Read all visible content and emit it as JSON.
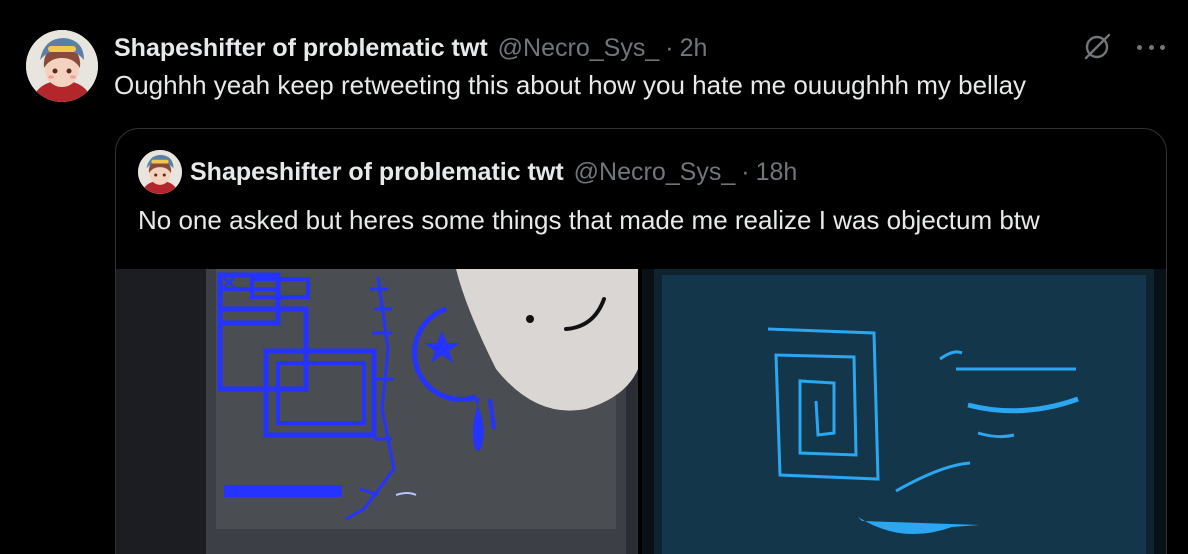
{
  "tweet": {
    "author_name": "Shapeshifter of problematic twt",
    "author_handle": "@Necro_Sys_",
    "separator": "·",
    "time": "2h",
    "text": "Oughhh yeah keep retweeting this about how you hate me ouuughhh my bellay",
    "icons": {
      "grok": "grok-slash-icon",
      "more": "more-horizontal-icon"
    }
  },
  "quoted_tweet": {
    "author_name": "Shapeshifter of problematic twt",
    "author_handle": "@Necro_Sys_",
    "separator": "·",
    "time": "18h",
    "text": "No one asked but heres some things that made me realize I was objectum btw"
  },
  "colors": {
    "background": "#000000",
    "text_primary": "#e7e9ea",
    "text_secondary": "#71767b",
    "border": "#2f3336"
  }
}
